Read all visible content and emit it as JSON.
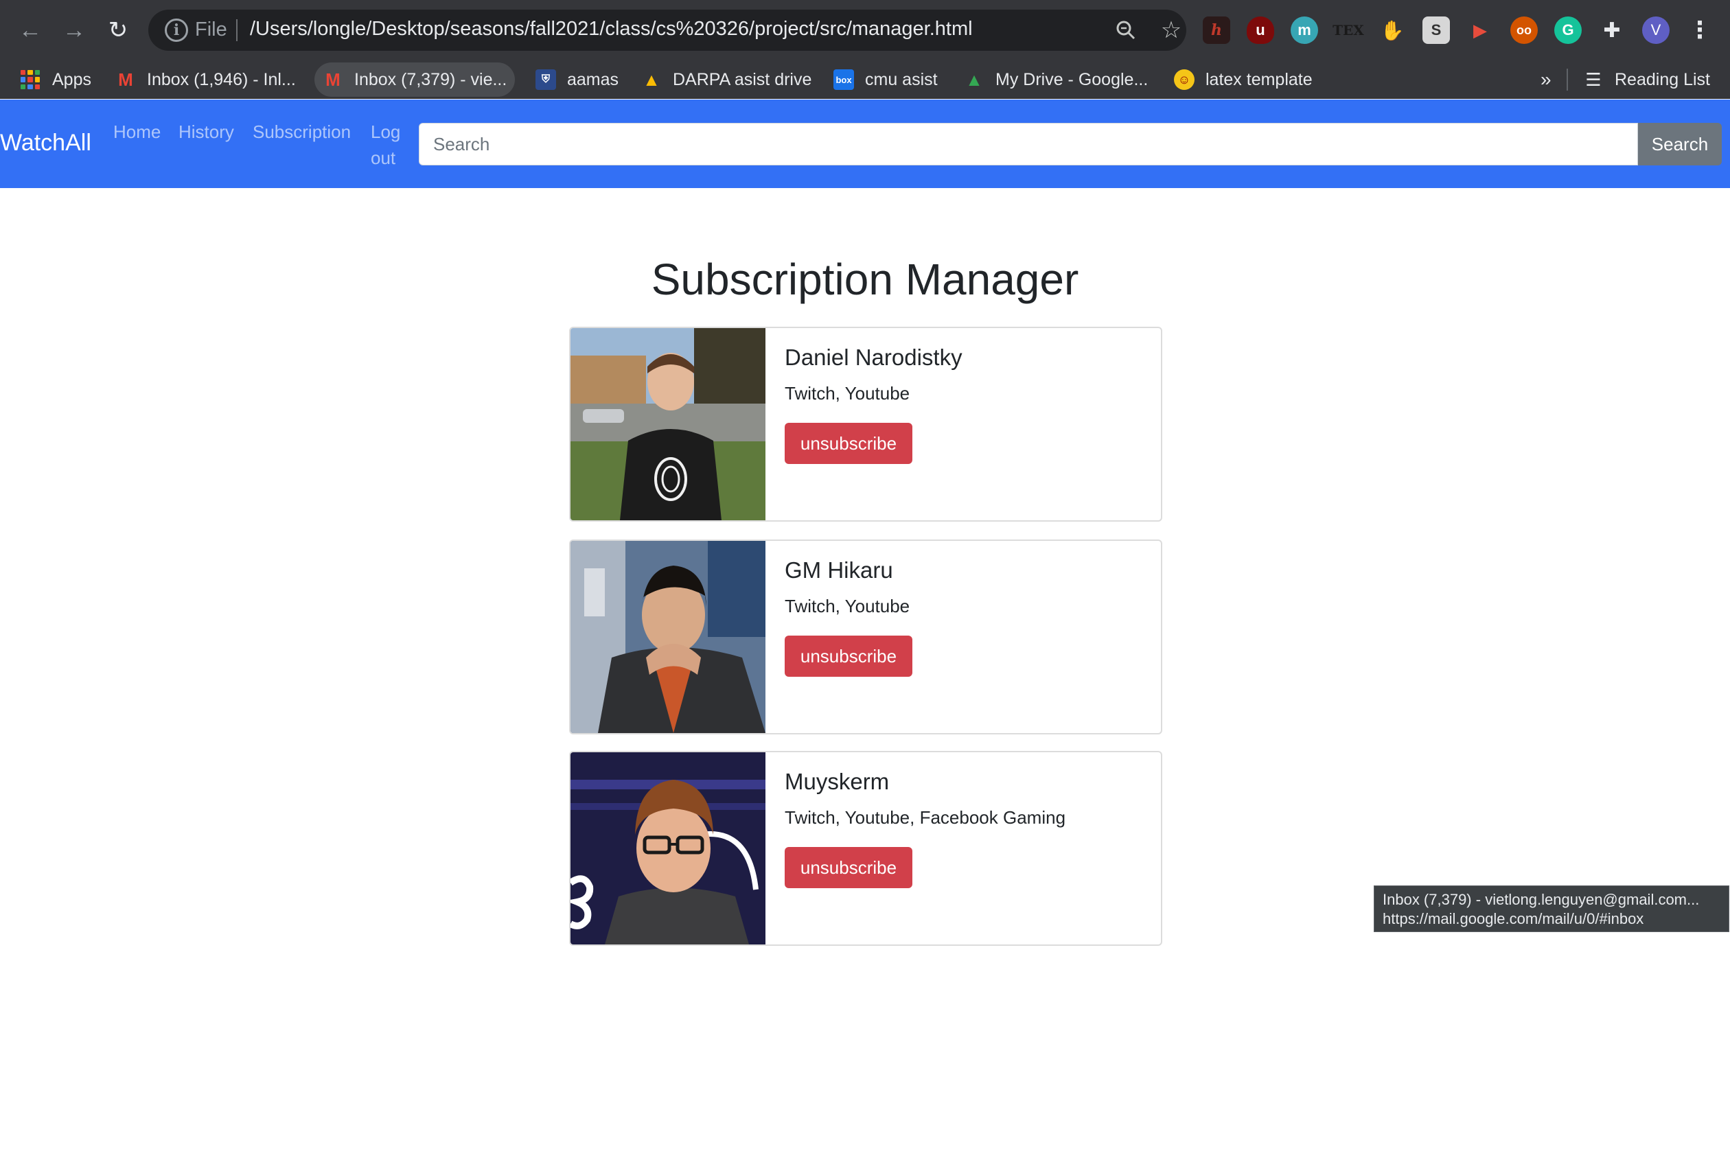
{
  "browser": {
    "url_scheme_label": "File",
    "url": "/Users/longle/Desktop/seasons/fall2021/class/cs%20326/project/src/manager.html",
    "profile_initial": "V",
    "extensions": [
      "hypothesis-icon",
      "ublock-icon",
      "mendeley-icon",
      "tex-icon",
      "hand-icon",
      "s-icon",
      "video-icon",
      "glasses-icon",
      "grammarly-icon",
      "puzzle-icon"
    ],
    "bookmarks": [
      {
        "label": "Apps",
        "icon": "apps-grid-icon"
      },
      {
        "label": "Inbox (1,946) - Inl...",
        "icon": "gmail-icon"
      },
      {
        "label": "Inbox (7,379) - vie...",
        "icon": "gmail-icon"
      },
      {
        "label": "aamas",
        "icon": "shield-icon"
      },
      {
        "label": "DARPA asist drive",
        "icon": "google-drive-icon"
      },
      {
        "label": "cmu asist",
        "icon": "box-icon"
      },
      {
        "label": "My Drive - Google...",
        "icon": "google-drive-icon"
      },
      {
        "label": "latex template",
        "icon": "emoji-icon"
      }
    ],
    "overflow_label": "»",
    "reading_list_label": "Reading List",
    "tooltip": {
      "line1": "Inbox (7,379) - vietlong.lenguyen@gmail.com...",
      "line2": "https://mail.google.com/mail/u/0/#inbox"
    }
  },
  "navbar": {
    "brand": "WatchAll",
    "links": [
      "Home",
      "History",
      "Subscription",
      "Log",
      "out"
    ],
    "search_placeholder": "Search",
    "search_button": "Search"
  },
  "main": {
    "title": "Subscription Manager",
    "subscriptions": [
      {
        "name": "Daniel Narodistky",
        "platforms": "Twitch, Youtube",
        "action": "unsubscribe"
      },
      {
        "name": "GM Hikaru",
        "platforms": "Twitch, Youtube",
        "action": "unsubscribe"
      },
      {
        "name": "Muyskerm",
        "platforms": "Twitch, Youtube, Facebook Gaming",
        "action": "unsubscribe"
      }
    ]
  },
  "colors": {
    "navbar": "#3370f5",
    "danger": "#d1404a",
    "secondary": "#6c757d"
  }
}
